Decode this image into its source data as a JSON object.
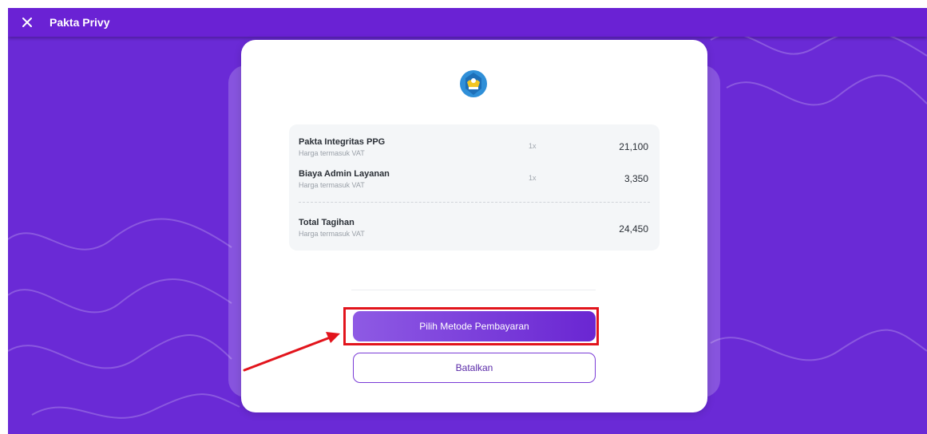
{
  "window": {
    "title": "Pakta Privy",
    "close_icon": "close-icon"
  },
  "bill": {
    "items": [
      {
        "name": "Pakta Integritas PPG",
        "note": "Harga termasuk VAT",
        "qty": "1x",
        "price": "21,100"
      },
      {
        "name": "Biaya Admin Layanan",
        "note": "Harga termasuk VAT",
        "qty": "1x",
        "price": "3,350"
      }
    ],
    "total": {
      "label": "Total Tagihan",
      "note": "Harga termasuk VAT",
      "amount": "24,450"
    }
  },
  "actions": {
    "pay_label": "Pilih Metode Pembayaran",
    "cancel_label": "Batalkan"
  },
  "colors": {
    "background": "#6a2ad6",
    "primary_button": "#7b3fdc",
    "highlight": "#e2141c"
  },
  "icons": [
    "close-icon",
    "tut-wuri-handayani-logo",
    "red-arrow-annotation"
  ]
}
